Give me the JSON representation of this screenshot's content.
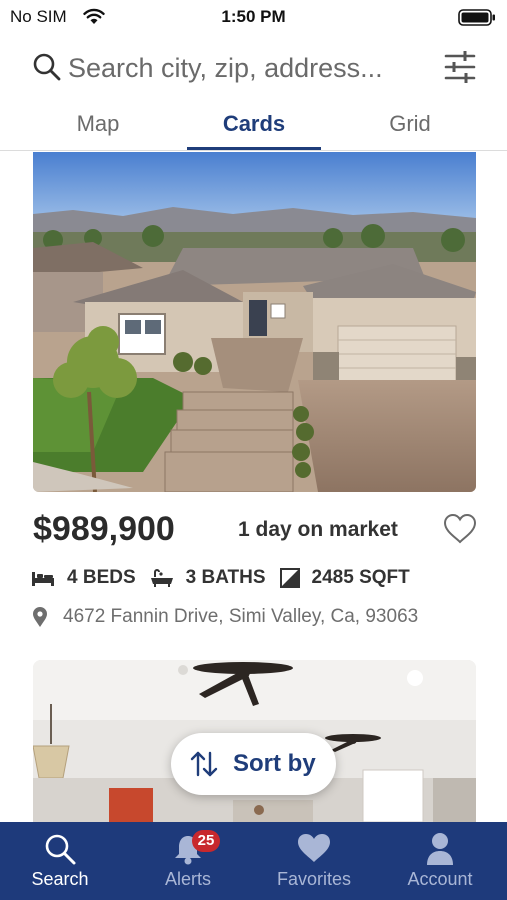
{
  "status_bar": {
    "carrier": "No SIM",
    "time": "1:50 PM"
  },
  "search": {
    "placeholder": "Search city, zip, address..."
  },
  "tabs": [
    {
      "label": "Map",
      "active": false
    },
    {
      "label": "Cards",
      "active": true
    },
    {
      "label": "Grid",
      "active": false
    }
  ],
  "listing": {
    "price": "$989,900",
    "days_on_market": "1 day on market",
    "beds": "4 BEDS",
    "baths": "3 BATHS",
    "sqft": "2485 SQFT",
    "address": "4672 Fannin Drive, Simi Valley, Ca, 93063"
  },
  "sort": {
    "label": "Sort by"
  },
  "bottom_nav": {
    "items": [
      {
        "label": "Search",
        "icon": "search-icon",
        "active": true
      },
      {
        "label": "Alerts",
        "icon": "bell-icon",
        "badge": "25"
      },
      {
        "label": "Favorites",
        "icon": "heart-icon"
      },
      {
        "label": "Account",
        "icon": "person-icon"
      }
    ]
  },
  "colors": {
    "brand": "#1e3a7b",
    "accent": "#1f3d7a",
    "badge": "#c8282d"
  }
}
